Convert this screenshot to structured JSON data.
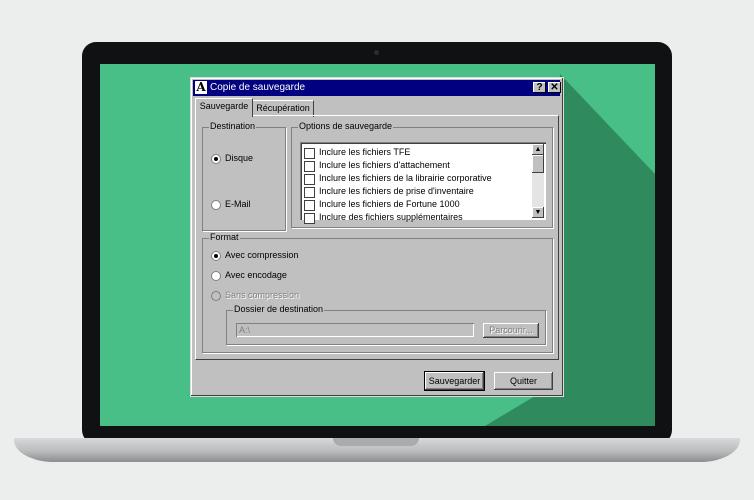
{
  "window": {
    "icon_letter": "A",
    "title": "Copie de sauvegarde",
    "help_glyph": "?",
    "close_glyph": "✕"
  },
  "tabs": [
    {
      "label": "Sauvegarde",
      "active": true
    },
    {
      "label": "Récupération",
      "active": false
    }
  ],
  "destination": {
    "legend": "Destination",
    "options": [
      {
        "label": "Disque",
        "selected": true
      },
      {
        "label": "E-Mail",
        "selected": false
      }
    ]
  },
  "options": {
    "legend": "Options de sauvegarde",
    "items": [
      {
        "label": "Inclure les fichiers TFE",
        "checked": false
      },
      {
        "label": "Inclure les fichiers d'attachement",
        "checked": false
      },
      {
        "label": "Inclure les fichiers de la librairie corporative",
        "checked": false
      },
      {
        "label": "Inclure les fichiers de prise d'inventaire",
        "checked": false
      },
      {
        "label": "Inclure les fichiers de Fortune 1000",
        "checked": false
      },
      {
        "label": "Inclure des fichiers supplémentaires",
        "checked": false
      }
    ]
  },
  "format": {
    "legend": "Format",
    "options": [
      {
        "label": "Avec compression",
        "selected": true,
        "enabled": true
      },
      {
        "label": "Avec encodage",
        "selected": false,
        "enabled": true
      },
      {
        "label": "Sans compression",
        "selected": false,
        "enabled": false
      }
    ],
    "folder": {
      "legend": "Dossier de destination",
      "path": "A:\\",
      "browse_label": "Parcourir..."
    }
  },
  "buttons": {
    "save_label": "Sauvegarder",
    "quit_label": "Quitter"
  },
  "colors": {
    "desktop": "#48bf86",
    "titlebar": "#000080",
    "dialog": "#c0c0c0"
  }
}
